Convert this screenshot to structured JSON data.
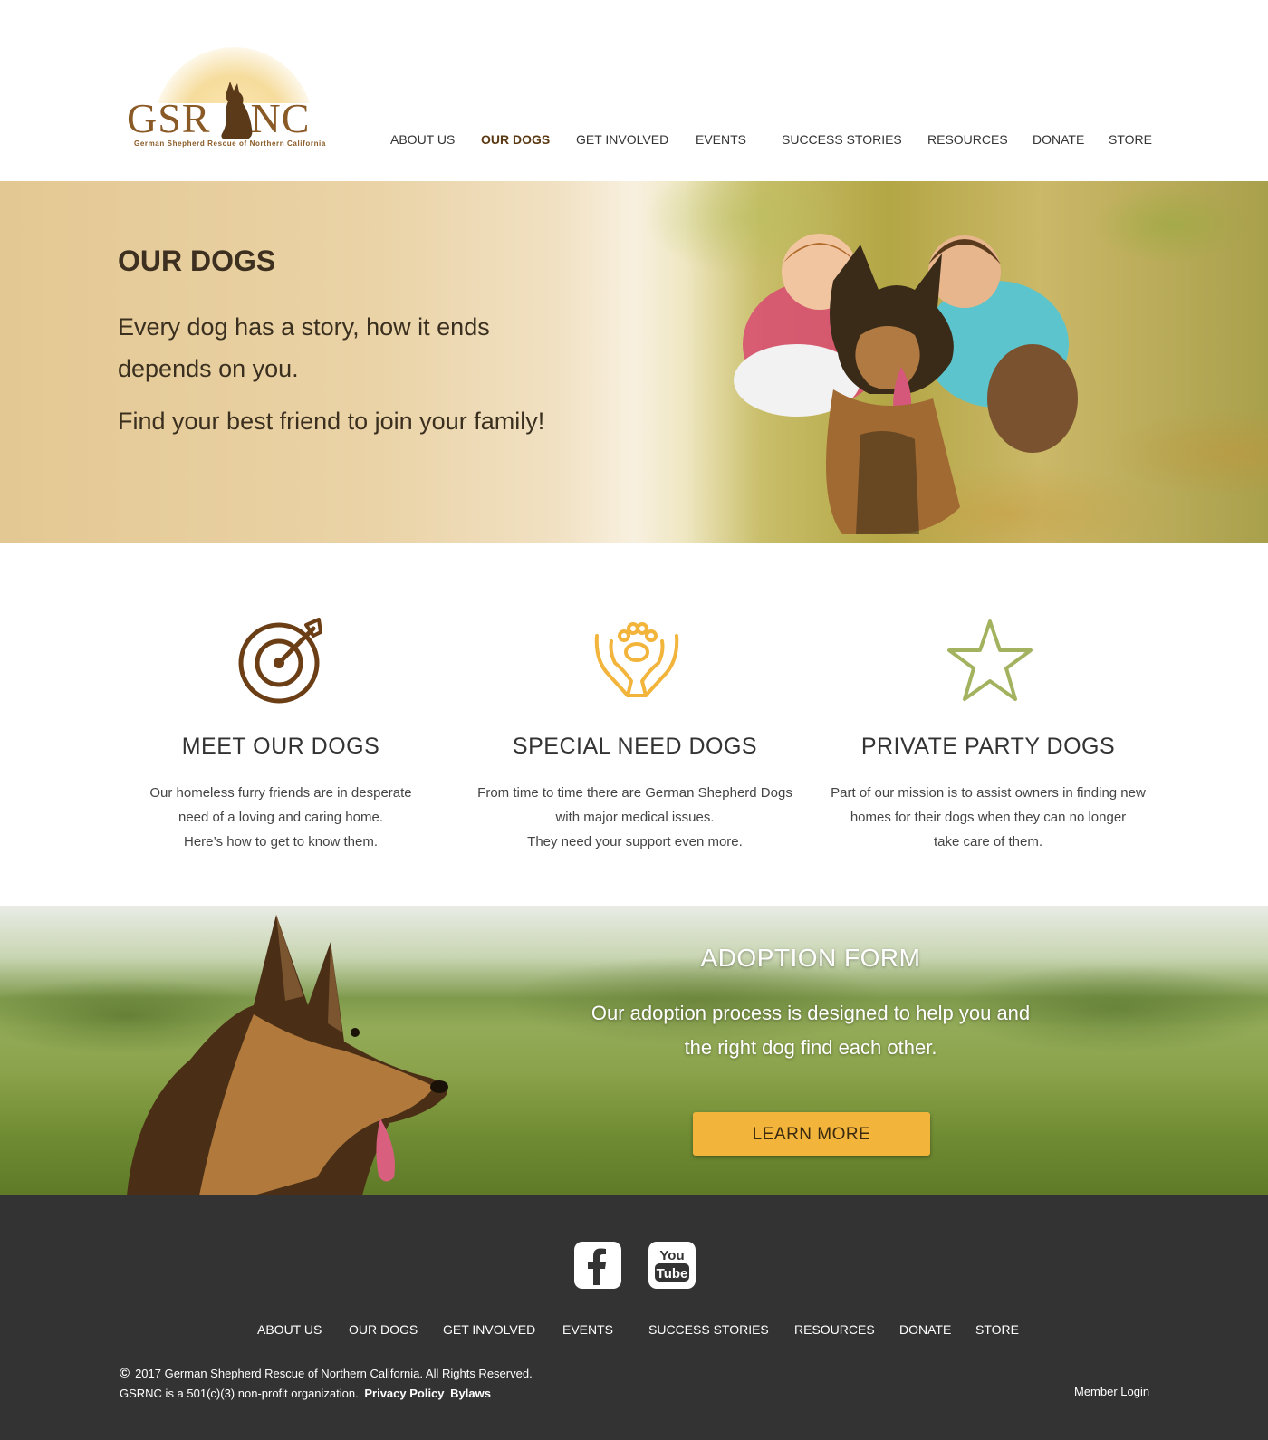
{
  "brand": {
    "logo_text_left": "GSR",
    "logo_text_right": "NC",
    "logo_subtitle": "German Shepherd Rescue of Northern California"
  },
  "nav": {
    "items": [
      "ABOUT US",
      "OUR DOGS",
      "GET INVOLVED",
      "EVENTS",
      "SUCCESS STORIES",
      "RESOURCES",
      "DONATE",
      "STORE"
    ],
    "active": "OUR DOGS"
  },
  "hero": {
    "title": "OUR DOGS",
    "line1": "Every dog has a story, how it ends depends on you.",
    "line2": "Find your best friend to join your family!"
  },
  "features": [
    {
      "icon": "target-icon",
      "title": "MEET OUR DOGS",
      "lines": [
        "Our homeless furry friends are in desperate",
        "need of a loving and caring home.",
        "Here’s how to get to know them."
      ]
    },
    {
      "icon": "paw-hands-icon",
      "title": "SPECIAL NEED DOGS",
      "lines": [
        "From time to time there are German Shepherd Dogs",
        "with major medical issues.",
        "They need your support even more."
      ]
    },
    {
      "icon": "star-icon",
      "title": "PRIVATE PARTY DOGS",
      "lines": [
        "Part of our mission is to assist owners in finding new",
        "homes for their dogs when they can no longer",
        "take care of them."
      ]
    }
  ],
  "adoption": {
    "title": "ADOPTION FORM",
    "text": "Our adoption process is designed to help you and the right dog find each other.",
    "button": "LEARN MORE"
  },
  "footer": {
    "social": [
      "facebook-icon",
      "youtube-icon"
    ],
    "youtube_text_top": "You",
    "youtube_text_bottom": "Tube",
    "nav": [
      "ABOUT US",
      "OUR DOGS",
      "GET INVOLVED",
      "EVENTS",
      "SUCCESS STORIES",
      "RESOURCES",
      "DONATE",
      "STORE"
    ],
    "copyright_symbol": "©",
    "copyright": "2017 German Shepherd Rescue of Northern California. All Rights Reserved.",
    "nonprofit": "GSRNC is a 501(c)(3) non-profit organization.",
    "privacy": "Privacy Policy",
    "bylaws": "Bylaws",
    "member_login": "Member Login"
  },
  "colors": {
    "brand_brown": "#8a5a26",
    "accent_orange": "#f2b43a",
    "star_green": "#a3b25f",
    "footer_bg": "#333333"
  }
}
